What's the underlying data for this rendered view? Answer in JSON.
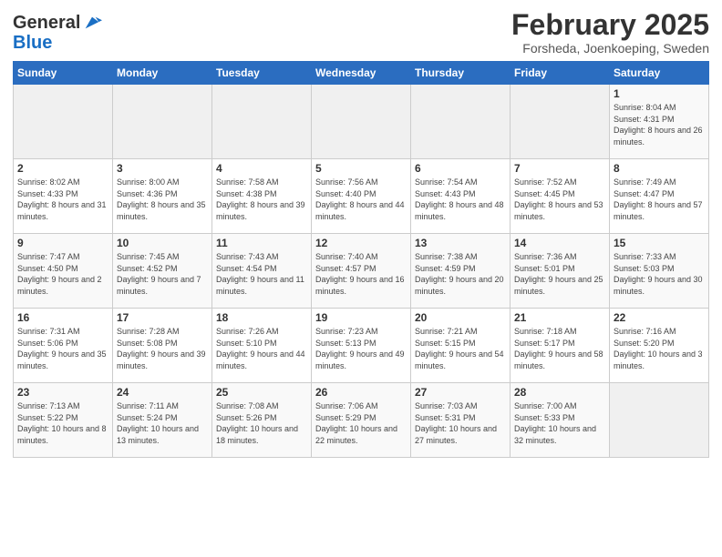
{
  "header": {
    "logo_general": "General",
    "logo_blue": "Blue",
    "month_title": "February 2025",
    "location": "Forsheda, Joenkoeping, Sweden"
  },
  "weekdays": [
    "Sunday",
    "Monday",
    "Tuesday",
    "Wednesday",
    "Thursday",
    "Friday",
    "Saturday"
  ],
  "weeks": [
    [
      {
        "day": "",
        "info": ""
      },
      {
        "day": "",
        "info": ""
      },
      {
        "day": "",
        "info": ""
      },
      {
        "day": "",
        "info": ""
      },
      {
        "day": "",
        "info": ""
      },
      {
        "day": "",
        "info": ""
      },
      {
        "day": "1",
        "info": "Sunrise: 8:04 AM\nSunset: 4:31 PM\nDaylight: 8 hours and 26 minutes."
      }
    ],
    [
      {
        "day": "2",
        "info": "Sunrise: 8:02 AM\nSunset: 4:33 PM\nDaylight: 8 hours and 31 minutes."
      },
      {
        "day": "3",
        "info": "Sunrise: 8:00 AM\nSunset: 4:36 PM\nDaylight: 8 hours and 35 minutes."
      },
      {
        "day": "4",
        "info": "Sunrise: 7:58 AM\nSunset: 4:38 PM\nDaylight: 8 hours and 39 minutes."
      },
      {
        "day": "5",
        "info": "Sunrise: 7:56 AM\nSunset: 4:40 PM\nDaylight: 8 hours and 44 minutes."
      },
      {
        "day": "6",
        "info": "Sunrise: 7:54 AM\nSunset: 4:43 PM\nDaylight: 8 hours and 48 minutes."
      },
      {
        "day": "7",
        "info": "Sunrise: 7:52 AM\nSunset: 4:45 PM\nDaylight: 8 hours and 53 minutes."
      },
      {
        "day": "8",
        "info": "Sunrise: 7:49 AM\nSunset: 4:47 PM\nDaylight: 8 hours and 57 minutes."
      }
    ],
    [
      {
        "day": "9",
        "info": "Sunrise: 7:47 AM\nSunset: 4:50 PM\nDaylight: 9 hours and 2 minutes."
      },
      {
        "day": "10",
        "info": "Sunrise: 7:45 AM\nSunset: 4:52 PM\nDaylight: 9 hours and 7 minutes."
      },
      {
        "day": "11",
        "info": "Sunrise: 7:43 AM\nSunset: 4:54 PM\nDaylight: 9 hours and 11 minutes."
      },
      {
        "day": "12",
        "info": "Sunrise: 7:40 AM\nSunset: 4:57 PM\nDaylight: 9 hours and 16 minutes."
      },
      {
        "day": "13",
        "info": "Sunrise: 7:38 AM\nSunset: 4:59 PM\nDaylight: 9 hours and 20 minutes."
      },
      {
        "day": "14",
        "info": "Sunrise: 7:36 AM\nSunset: 5:01 PM\nDaylight: 9 hours and 25 minutes."
      },
      {
        "day": "15",
        "info": "Sunrise: 7:33 AM\nSunset: 5:03 PM\nDaylight: 9 hours and 30 minutes."
      }
    ],
    [
      {
        "day": "16",
        "info": "Sunrise: 7:31 AM\nSunset: 5:06 PM\nDaylight: 9 hours and 35 minutes."
      },
      {
        "day": "17",
        "info": "Sunrise: 7:28 AM\nSunset: 5:08 PM\nDaylight: 9 hours and 39 minutes."
      },
      {
        "day": "18",
        "info": "Sunrise: 7:26 AM\nSunset: 5:10 PM\nDaylight: 9 hours and 44 minutes."
      },
      {
        "day": "19",
        "info": "Sunrise: 7:23 AM\nSunset: 5:13 PM\nDaylight: 9 hours and 49 minutes."
      },
      {
        "day": "20",
        "info": "Sunrise: 7:21 AM\nSunset: 5:15 PM\nDaylight: 9 hours and 54 minutes."
      },
      {
        "day": "21",
        "info": "Sunrise: 7:18 AM\nSunset: 5:17 PM\nDaylight: 9 hours and 58 minutes."
      },
      {
        "day": "22",
        "info": "Sunrise: 7:16 AM\nSunset: 5:20 PM\nDaylight: 10 hours and 3 minutes."
      }
    ],
    [
      {
        "day": "23",
        "info": "Sunrise: 7:13 AM\nSunset: 5:22 PM\nDaylight: 10 hours and 8 minutes."
      },
      {
        "day": "24",
        "info": "Sunrise: 7:11 AM\nSunset: 5:24 PM\nDaylight: 10 hours and 13 minutes."
      },
      {
        "day": "25",
        "info": "Sunrise: 7:08 AM\nSunset: 5:26 PM\nDaylight: 10 hours and 18 minutes."
      },
      {
        "day": "26",
        "info": "Sunrise: 7:06 AM\nSunset: 5:29 PM\nDaylight: 10 hours and 22 minutes."
      },
      {
        "day": "27",
        "info": "Sunrise: 7:03 AM\nSunset: 5:31 PM\nDaylight: 10 hours and 27 minutes."
      },
      {
        "day": "28",
        "info": "Sunrise: 7:00 AM\nSunset: 5:33 PM\nDaylight: 10 hours and 32 minutes."
      },
      {
        "day": "",
        "info": ""
      }
    ]
  ]
}
